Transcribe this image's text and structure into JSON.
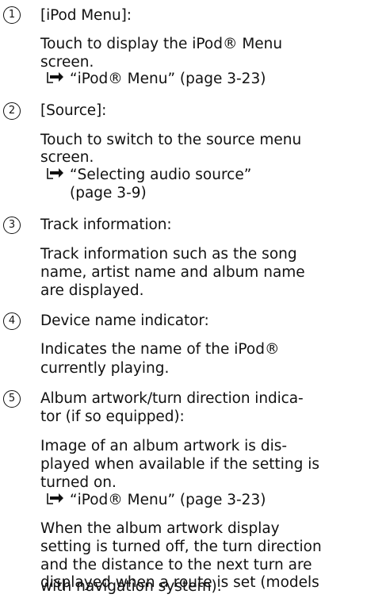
{
  "items": [
    {
      "number": "1",
      "heading": "[iPod Menu]:",
      "body": [
        "Touch to display the iPod® Menu",
        "screen."
      ],
      "ref": "“iPod® Menu” (page 3-23)"
    },
    {
      "number": "2",
      "heading": "[Source]:",
      "body": [
        "Touch to switch to the source menu",
        "screen."
      ],
      "ref": "“Selecting audio source”",
      "ref_cont": "(page 3-9)"
    },
    {
      "number": "3",
      "heading": "Track information:",
      "body": [
        "Track information such as the song",
        "name, artist name and album name",
        "are displayed."
      ]
    },
    {
      "number": "4",
      "heading": "Device name indicator:",
      "body": [
        "Indicates the name of the iPod®",
        "currently playing."
      ]
    },
    {
      "number": "5",
      "heading_lines": [
        "Album artwork/turn direction indica-",
        "tor (if so equipped):"
      ],
      "body": [
        "Image of an album artwork is dis-",
        "played when available if the setting is",
        "turned on."
      ],
      "ref": "“iPod® Menu” (page 3-23)",
      "body2": [
        "When the album artwork display",
        "setting is turned off, the turn direction",
        "and the distance to the next turn are",
        "displayed when a route is set (models",
        "with navigation system)."
      ]
    }
  ],
  "ref_icon": "reference-arrow-icon"
}
